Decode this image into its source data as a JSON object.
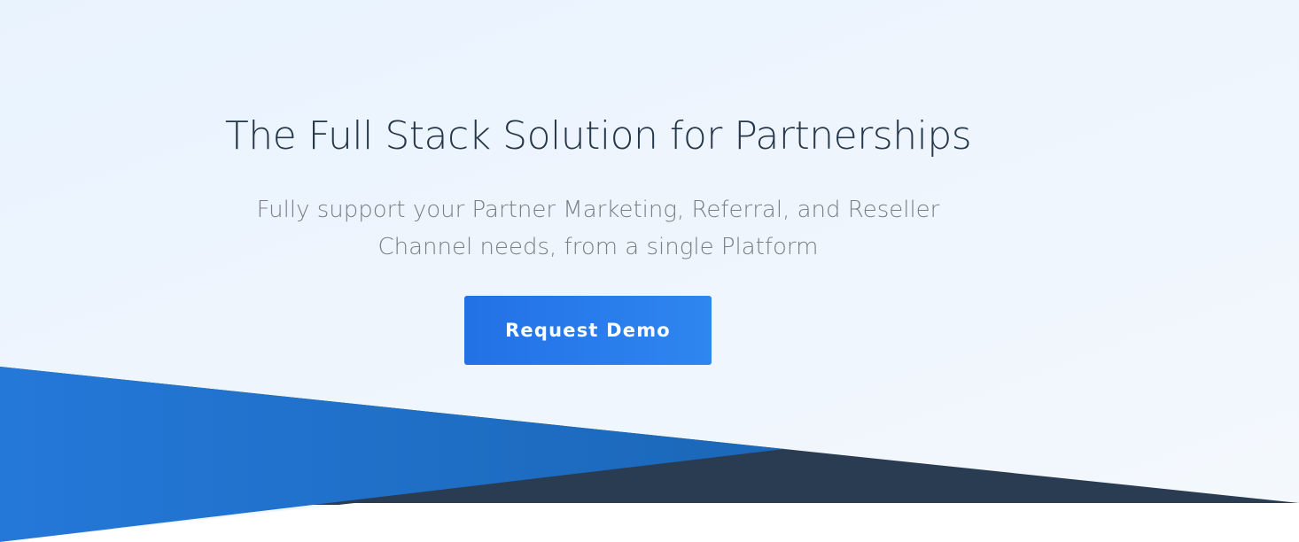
{
  "hero": {
    "title": "The Full Stack Solution for Partnerships",
    "subtitle": "Fully support your Partner Marketing, Referral, and Reseller Channel needs, from a single Platform",
    "cta_label": "Request Demo"
  },
  "colors": {
    "title": "#26374a",
    "subtitle": "#7b7f85",
    "button_start": "#2271e6",
    "button_end": "#2f86f0",
    "navy_shape": "#2a3c52",
    "blue_shape": "#1f6ec9"
  }
}
